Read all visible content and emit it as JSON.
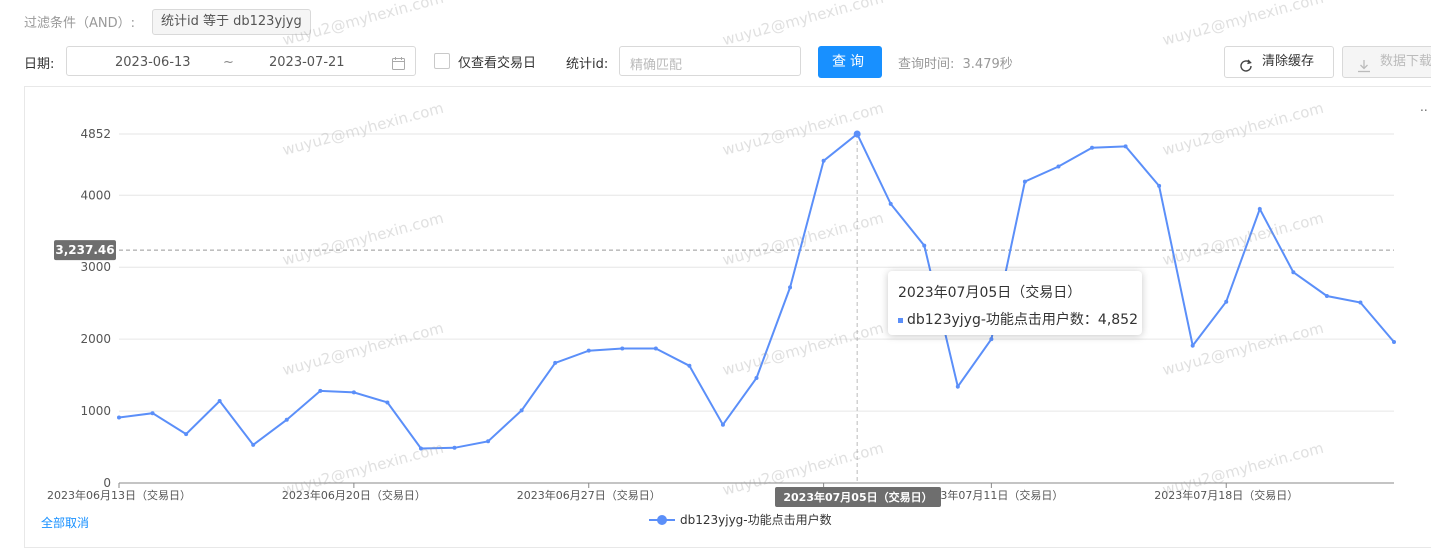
{
  "filter": {
    "label": "过滤条件（AND）:",
    "tag": "统计id 等于 db123yjyg"
  },
  "toolbar": {
    "date_label": "日期:",
    "date_start": "2023-06-13",
    "date_sep": "~",
    "date_end": "2023-07-21",
    "trade_day_only_label": "仅查看交易日",
    "stat_id_label": "统计id:",
    "stat_id_placeholder": "精确匹配",
    "query_button": "查询",
    "query_time_label": "查询时间:",
    "query_time_value": "3.479秒",
    "clear_cache_button": "清除缓存",
    "download_button": "数据下载"
  },
  "chart": {
    "cancel_all_label": "全部取消",
    "menu_label": "..",
    "crosshair_y_label": "3,237.46",
    "crosshair_x_label": "2023年07月05日（交易日）",
    "tooltip": {
      "title": "2023年07月05日（交易日）",
      "series_label": "db123yjyg-功能点击用户数",
      "value": "4,852"
    }
  },
  "watermark": "wuyu2@myhexin.com",
  "colors": {
    "line": "#5b8ff9",
    "primary": "#1890ff",
    "grid": "#e6e6e6"
  },
  "chart_data": {
    "type": "line",
    "x_tick_labels": [
      "2023年06月13日（交易日）",
      "2023年06月20日（交易日）",
      "2023年06月27日（交易日）",
      "2023年07月05日（交易日）",
      "2023年07月11日（交易日）",
      "2023年07月18日（交易日）"
    ],
    "x_tick_indices": [
      0,
      7,
      14,
      21,
      26,
      33
    ],
    "y_tick_labels": [
      "0",
      "1000",
      "2000",
      "3000",
      "4000",
      "4852"
    ],
    "y_ticks": [
      0,
      1000,
      2000,
      3000,
      4000,
      4852
    ],
    "ylim": [
      0,
      4852
    ],
    "grid": true,
    "legend_position": "bottom-center",
    "series": [
      {
        "name": "db123yjyg-功能点击用户数",
        "values": [
          910,
          970,
          680,
          1140,
          530,
          880,
          1280,
          1260,
          1120,
          480,
          490,
          580,
          1010,
          1670,
          1840,
          1870,
          1870,
          1630,
          810,
          1460,
          2720,
          4480,
          4852,
          3880,
          3300,
          1340,
          2000,
          4190,
          4400,
          4660,
          4680,
          4130,
          1910,
          2520,
          3810,
          2930,
          2600,
          2510,
          1960
        ]
      }
    ]
  }
}
